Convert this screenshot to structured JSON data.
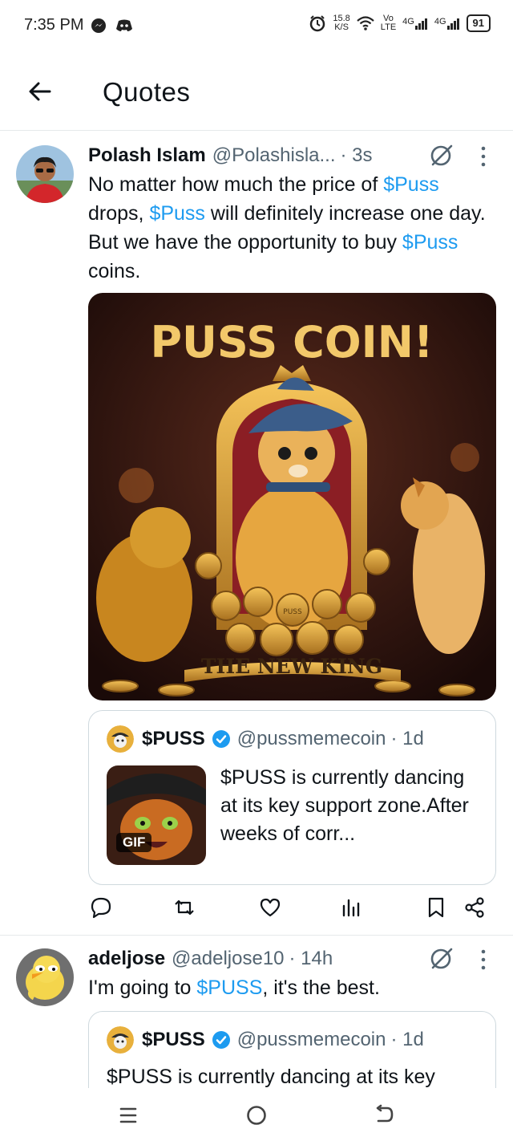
{
  "status_bar": {
    "time": "7:35 PM",
    "speed_value": "15.8",
    "speed_unit": "K/S",
    "volte_top": "Vo",
    "volte_bottom": "LTE",
    "net1": "4G",
    "net2": "4G",
    "battery": "91",
    "icons": [
      "messenger-icon",
      "discord-icon",
      "alarm-icon",
      "wifi-icon",
      "signal-icon",
      "battery-icon"
    ]
  },
  "header": {
    "title": "Quotes",
    "back_icon": "arrow-left-icon"
  },
  "posts": [
    {
      "author": "Polash Islam",
      "handle": "@Polashisla...",
      "time": "· 3s",
      "text_parts": [
        "No matter how much the price of ",
        "$Puss",
        "\ndrops, ",
        "$Puss",
        " will definitely increase one day. But we have the opportunity to buy ",
        "$Puss",
        " coins."
      ],
      "media": {
        "headline": "PUSS COIN!",
        "banner": "THE NEW KING",
        "coin_label": "PUSS"
      },
      "quote": {
        "name": "$PUSS",
        "handle": "@pussmemecoin",
        "time": "· 1d",
        "text": "$PUSS is currently dancing at its key support zone.After weeks of corr...",
        "media_badge": "GIF"
      },
      "actions": [
        "reply-icon",
        "repost-icon",
        "like-icon",
        "views-icon",
        "bookmark-icon",
        "share-icon"
      ]
    },
    {
      "author": "adeljose",
      "handle": "@adeljose10",
      "time": "· 14h",
      "text_parts": [
        "I'm going to ",
        "$PUSS",
        ", it's the best."
      ],
      "quote": {
        "name": "$PUSS",
        "handle": "@pussmemecoin",
        "time": "· 1d",
        "text": "$PUSS is currently dancing at its key"
      }
    }
  ],
  "colors": {
    "accent": "#1d9bf0",
    "text": "#0f1419",
    "secondary": "#536471",
    "border": "#cfd9de"
  }
}
